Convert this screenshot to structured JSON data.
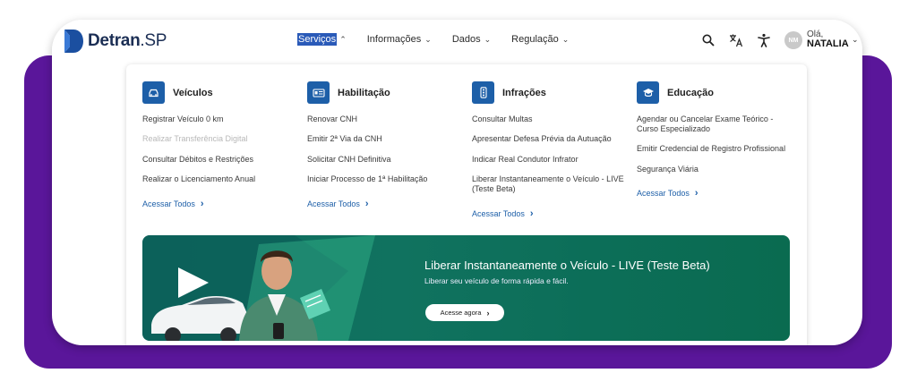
{
  "brand": {
    "name_bold": "Detran",
    "name_suffix": ".SP",
    "logo_color": "#1b4fa0"
  },
  "nav": [
    {
      "label": "Serviços",
      "active": true
    },
    {
      "label": "Informações"
    },
    {
      "label": "Dados"
    },
    {
      "label": "Regulação"
    }
  ],
  "header_icons": [
    "search-icon",
    "translate-icon",
    "accessibility-icon"
  ],
  "user": {
    "initials": "NM",
    "greeting": "Olá,",
    "name": "NATALIA"
  },
  "columns": [
    {
      "title": "Veículos",
      "icon": "car-icon",
      "items": [
        {
          "label": "Registrar Veículo 0 km"
        },
        {
          "label": "Realizar Transferência Digital",
          "disabled": true
        },
        {
          "label": "Consultar Débitos e Restrições"
        },
        {
          "label": "Realizar o Licenciamento Anual"
        }
      ],
      "see_all": "Acessar Todos"
    },
    {
      "title": "Habilitação",
      "icon": "license-card-icon",
      "items": [
        {
          "label": "Renovar CNH"
        },
        {
          "label": "Emitir 2ª Via da CNH"
        },
        {
          "label": "Solicitar CNH Definitiva"
        },
        {
          "label": "Iniciar Processo de 1ª Habilitação"
        }
      ],
      "see_all": "Acessar Todos"
    },
    {
      "title": "Infrações",
      "icon": "traffic-light-icon",
      "items": [
        {
          "label": "Consultar Multas"
        },
        {
          "label": "Apresentar Defesa Prévia da Autuação"
        },
        {
          "label": "Indicar Real Condutor Infrator"
        },
        {
          "label": "Liberar Instantaneamente o Veículo - LIVE (Teste Beta)"
        }
      ],
      "see_all": "Acessar Todos"
    },
    {
      "title": "Educação",
      "icon": "graduation-cap-icon",
      "items": [
        {
          "label": "Agendar ou Cancelar Exame Teórico - Curso Especializado"
        },
        {
          "label": "Emitir Credencial de Registro Profissional"
        },
        {
          "label": "Segurança Viária"
        }
      ],
      "see_all": "Acessar Todos"
    }
  ],
  "banner": {
    "title": "Liberar Instantaneamente o Veículo - LIVE (Teste Beta)",
    "subtitle": "Liberar seu veículo de forma rápida e fácil.",
    "button": "Acesse agora",
    "color": "#0f6b60"
  },
  "colors": {
    "accent": "#1d5fa8",
    "frame": "#5a169a"
  }
}
